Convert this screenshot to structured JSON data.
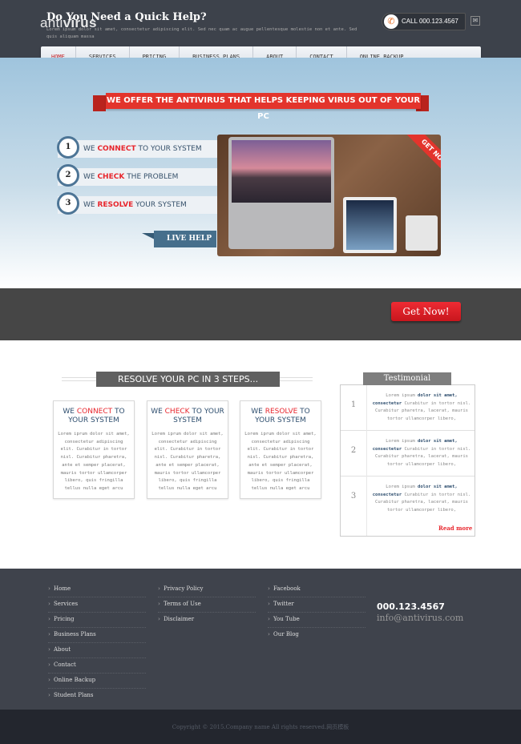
{
  "header": {
    "logo_light": "anti",
    "logo_bold": "virus",
    "call": "CALL 000.123.4567"
  },
  "nav": [
    "HOME",
    "SERVICES",
    "PRICING",
    "BUSINESS PLANS",
    "ABOUT",
    "CONTACT",
    "ONLINE BACKUP"
  ],
  "hero": {
    "ribbon": "WE OFFER THE ANTIVIRUS THAT HELPS KEEPING VIRUS OUT OF YOUR PC",
    "steps": [
      {
        "num": "1",
        "pre": "WE ",
        "hl": "CONNECT",
        "post": " TO YOUR SYSTEM"
      },
      {
        "num": "2",
        "pre": "WE ",
        "hl": "CHECK",
        "post": " THE PROBLEM"
      },
      {
        "num": "3",
        "pre": "WE ",
        "hl": "RESOLVE",
        "post": " YOUR SYSTEM"
      }
    ],
    "live_help": "LIVE HELP",
    "get_now_banner": "GET NOW!"
  },
  "help": {
    "title": "Do You Need a Quick Help?",
    "text": "Lorem ipsum dolor sit amet, consectetur adipiscing elit. Sed nec quam ac augue pellentesque molestie non et ante. Sed quis aliquam massa",
    "button": "Get Now!"
  },
  "steps_section": {
    "title": "RESOLVE YOUR PC IN 3 STEPS...",
    "cards": [
      {
        "pre": "WE ",
        "hl": "CONNECT",
        "post": " TO YOUR SYSTEM",
        "body": "Lorem iprum dolor sit amet, consectetur adipiscing elit. Curabitur in tortor nisl. Curabitur pharetra, ante et semper placerat, mauris tortor ullamcorper libero, quis fringilla tellus nulla eget arcu"
      },
      {
        "pre": "WE ",
        "hl": "CHECK",
        "post": " TO YOUR SYSTEM",
        "body": "Lorem iprum dolor sit amet, consectetur adipiscing elit. Curabitur in tortor nisl. Curabitur pharetra, ante et semper placerat, mauris tortor ullamcorper libero, quis fringilla tellus nulla eget arcu"
      },
      {
        "pre": "WE ",
        "hl": "RESOLVE",
        "post": " TO YOUR SYSTEM",
        "body": "Lorem iprum dolor sit amet, consectetur adipiscing elit. Curabitur in tortor nisl. Curabitur pharetra, ante et semper placerat, mauris tortor ullamcorper libero, quis fringilla tellus nulla eget arcu"
      }
    ]
  },
  "testimonial": {
    "title": "Testimonial",
    "items": [
      {
        "num": "1",
        "pre": "Lorem ipsum ",
        "bold": "dolor sit amet, consectetur",
        "post": " Curabitur in tortor nisl. Curabitur pharetra, lacerat, mauris tortor ullamcorper libero,"
      },
      {
        "num": "2",
        "pre": "Lorem ipsum ",
        "bold": "dolor sit amet, consectetur",
        "post": " Curabitur in tortor nisl. Curabitur pharetra, lacerat, mauris tortor ullamcorper libero,"
      },
      {
        "num": "3",
        "pre": "Lorem ipsum ",
        "bold": "dolor sit amet, consectetur",
        "post": " Curabitur in tortor nisl. Curabitur pharetra, lacerat, mauris tortor ullamcorper libero,"
      }
    ],
    "read_more": "Read more"
  },
  "footer": {
    "col1": [
      "Home",
      "Services",
      "Pricing",
      "Business Plans",
      "About",
      "Contact",
      "Online Backup",
      "Student Plans"
    ],
    "col2": [
      "Privacy Policy",
      "Terms of Use",
      "Disclaimer"
    ],
    "col3": [
      "Facebook",
      "Twitter",
      "You Tube",
      "Our Blog"
    ],
    "phone": "000.123.4567",
    "email": "info@antivirus.com",
    "copyright": "Copyright © 2015.Company name All rights reserved.网页模板"
  },
  "colors": {
    "accent": "#e3342c",
    "header": "#3d424b",
    "nav_active": "#c4282d",
    "step_blue": "#466f8c"
  }
}
